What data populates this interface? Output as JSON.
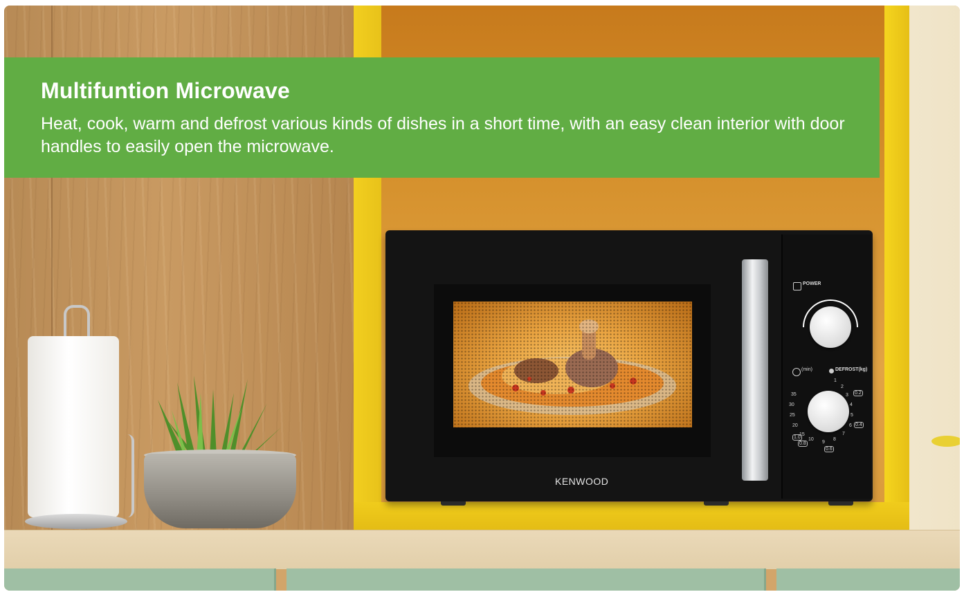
{
  "banner": {
    "title": "Multifuntion Microwave",
    "body": "Heat, cook, warm and defrost various kinds of dishes in a short time, with an easy clean interior with door handles to easily open the microwave."
  },
  "microwave": {
    "brand": "KENWOOD",
    "power_label": "POWER",
    "timer_label": "(min)",
    "defrost_label": "DEFROST(kg)",
    "timer_ticks": [
      "35",
      "30",
      "25",
      "20",
      "15",
      "10",
      "9",
      "8",
      "7",
      "6",
      "5",
      "4",
      "3",
      "2",
      "1"
    ],
    "defrost_ticks": [
      "0.2",
      "0.4",
      "0.6",
      "0.8",
      "1.0"
    ]
  },
  "colors": {
    "banner": "#61ad44",
    "cabinet": "#f2cf1f",
    "microwave_body": "#141414"
  },
  "icons": [
    "power-icon",
    "clock-icon",
    "defrost-icon"
  ]
}
